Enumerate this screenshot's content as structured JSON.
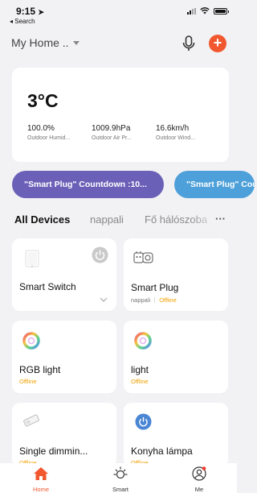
{
  "status": {
    "time": "9:15",
    "back_label": "◂ Search"
  },
  "header": {
    "home_name": "My Home .."
  },
  "weather": {
    "temperature": "3°C",
    "stats": [
      {
        "value": "100.0%",
        "label": "Outdoor Humid..."
      },
      {
        "value": "1009.9hPa",
        "label": "Outdoor Air Pr..."
      },
      {
        "value": "16.6km/h",
        "label": "Outdoor Wind..."
      }
    ]
  },
  "scenes": [
    {
      "label": "\"Smart Plug\" Countdown :10..."
    },
    {
      "label": "\"Smart Plug\" Countdown"
    }
  ],
  "tabs": {
    "all": "All Devices",
    "room1": "nappali",
    "room2": "Fő hálószoba",
    "more": "···"
  },
  "devices": [
    {
      "name": "Smart Switch",
      "room": "",
      "status": ""
    },
    {
      "name": "Smart Plug",
      "room": "nappali",
      "status": "Offline"
    },
    {
      "name": "RGB light",
      "status": "Offline"
    },
    {
      "name": "light",
      "status": "Offline"
    },
    {
      "name": "Single dimmin...",
      "status": "Offline"
    },
    {
      "name": "Konyha lámpa",
      "status": "Offline"
    }
  ],
  "nav": {
    "home": "Home",
    "smart": "Smart",
    "me": "Me"
  },
  "colors": {
    "accent": "#f2582f",
    "offline": "#f2a000",
    "scene1": "#6a60b8",
    "scene2": "#4ea0da"
  }
}
